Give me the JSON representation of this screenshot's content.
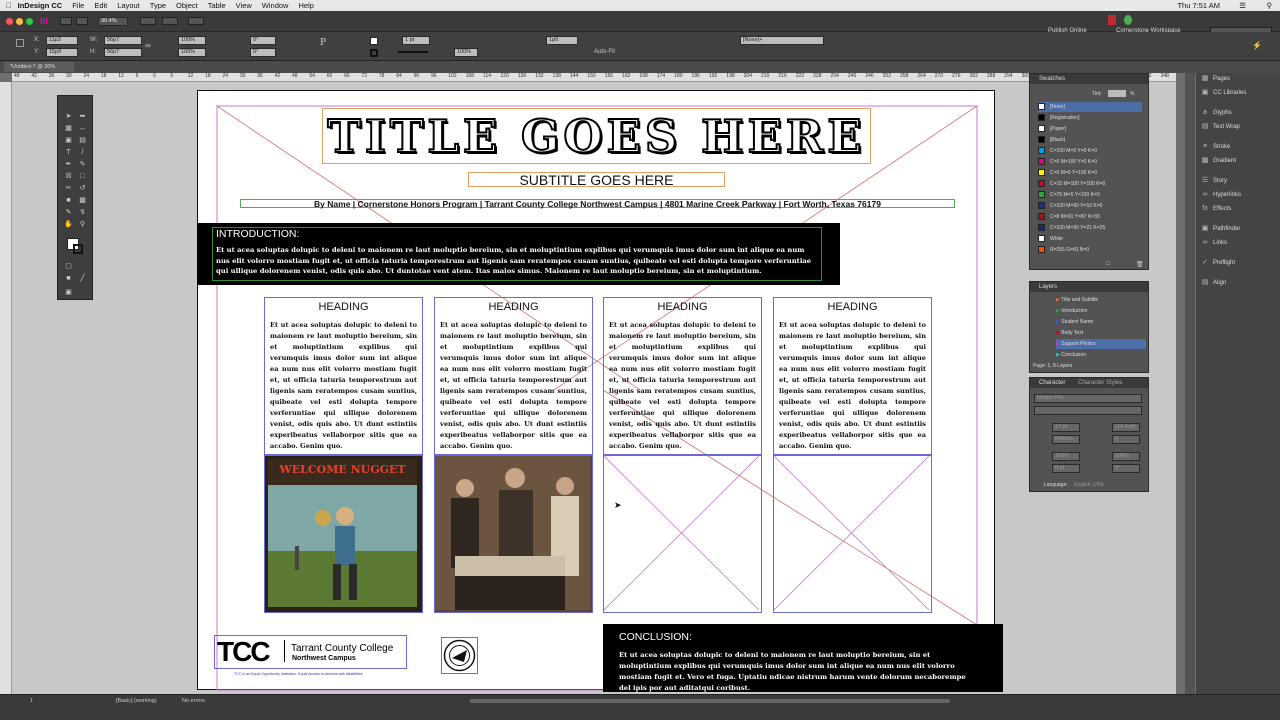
{
  "menubar": {
    "app_name": "InDesign CC",
    "items": [
      "File",
      "Edit",
      "Layout",
      "Type",
      "Object",
      "Table",
      "View",
      "Window",
      "Help"
    ],
    "clock": "Thu 7:51 AM"
  },
  "appbar": {
    "zoom": "30.4%",
    "publish": "Publish Online",
    "workspace": "Cornerstone Workspace"
  },
  "control": {
    "x": "11p3",
    "y": "15p9",
    "w": "56p7",
    "h": "56p7",
    "scale_x": "100%",
    "scale_y": "100%",
    "angle": "0°",
    "shear": "0°",
    "stroke": "1 pt",
    "style": "[None]+",
    "gap": "100%",
    "autofit": "Auto-Fit",
    "spacing": "1p0"
  },
  "doc_tab": "*Untitled-7 @ 30%",
  "ruler": [
    "48",
    "42",
    "36",
    "30",
    "24",
    "18",
    "12",
    "6",
    "0",
    "6",
    "12",
    "18",
    "24",
    "30",
    "36",
    "42",
    "48",
    "54",
    "60",
    "66",
    "72",
    "78",
    "84",
    "90",
    "96",
    "102",
    "108",
    "114",
    "120",
    "126",
    "132",
    "138",
    "144",
    "150",
    "156",
    "162",
    "168",
    "174",
    "180",
    "186",
    "192",
    "198",
    "204",
    "210",
    "216",
    "222",
    "228",
    "234",
    "240",
    "246",
    "252",
    "258",
    "264",
    "270",
    "276",
    "282",
    "288",
    "294",
    "300",
    "306",
    "312",
    "318",
    "324",
    "330",
    "336",
    "342",
    "348"
  ],
  "document": {
    "title": "TITLE GOES HERE",
    "subtitle": "SUBTITLE GOES HERE",
    "byline": "By Name |  Cornerstone Honors Program  |  Tarrant County College Northwest Campus  |  4801 Marine Creek Parkway  |  Fort Worth, Texas  76179",
    "intro_title": "INTRODUCTION:",
    "intro_body": "Et ut acea soluptas dolupic to deleni to maionem re laut moluptio bereium, sin et moluptintium explibus qui verumquis imus dolor sum int alique ea num nus elit volorro mostiam fugit et, ut officia taturia temporestrum aut ligenis sam reratempos cusam suntius, quibeate vel esti dolupta tempore verferuntiae qui ullique dolorenem venist, odis quis abo. Ut duntotae vent atem. Itas maios simus. Maionem re laut moluptio bereium, sin et moluptintium.",
    "columns": [
      {
        "heading": "HEADING",
        "body": "Et ut acea soluptas dolupic to deleni to maionem re laut moluptio bereium, sin et moluptintium explibus qui verumquis imus dolor sum int alique ea num nus elit volorro mostiam fugit et, ut officia taturia temporestrum aut ligenis sam reratempos cusam suntius, quibeate vel esti dolupta tempore verferuntiae qui ullique dolorenem venist, odis quis abo. Ut dunt estintiis experibeatus vellaborpor sitis que ea accabo. Genim quo."
      },
      {
        "heading": "HEADING",
        "body": "Et ut acea soluptas dolupic to deleni to maionem re laut moluptio bereium, sin et moluptintium explibus qui verumquis imus dolor sum int alique ea num nus elit volorro mostiam fugit et, ut officia taturia temporestrum aut ligenis sam reratempos cusam suntius, quibeate vel esti dolupta tempore verferuntiae qui ullique dolorenem venist, odis quis abo. Ut dunt estintiis experibeatus vellaborpor sitis que ea accabo. Genim quo."
      },
      {
        "heading": "HEADING",
        "body": "Et ut acea soluptas dolupic to deleni to maionem re laut moluptio bereium, sin et moluptintium explibus qui verumquis imus dolor sum int alique ea num nus elit volorro mostiam fugit et, ut officia taturia temporestrum aut ligenis sam reratempos cusam suntius, quibeate vel esti dolupta tempore verferuntiae qui ullique dolorenem venist, odis quis abo. Ut dunt estintiis experibeatus vellaborpor sitis que ea accabo. Genim quo."
      },
      {
        "heading": "HEADING",
        "body": "Et ut acea soluptas dolupic to deleni to maionem re laut moluptio bereium, sin et moluptintium explibus qui verumquis imus dolor sum int alique ea num nus elit volorro mostiam fugit et, ut officia taturia temporestrum aut ligenis sam reratempos cusam suntius, quibeate vel esti dolupta tempore verferuntiae qui ullique dolorenem venist, odis quis abo. Ut dunt estintiis experibeatus vellaborpor sitis que ea accabo. Genim quo."
      }
    ],
    "image1_caption": "WELCOME NUGGET",
    "conclusion_title": "CONCLUSION:",
    "conclusion_body": "Et ut acea soluptas dolupic to deleni to maionem re laut moluptio bereium, sin et moluptintium explibus qui verumquis imus dolor sum int alique ea num nus elit volorro mostiam fugit et. Vero et fuga. Uptatiu ndicae nistrum harum vente dolorum necaborempe del ipis por aut aditatqui coribust.",
    "logo_tcc": "TCC",
    "logo_college": "Tarrant County College",
    "logo_campus": "Northwest Campus",
    "logo_fine_print": "TCC is an Equal Opportunity Institution. Equal Access to persons with disabilities."
  },
  "swatches": {
    "title": "Swatches",
    "tint_label": "Tint:",
    "tint_value": "%",
    "items": [
      {
        "name": "[None]",
        "color": "#ffffff"
      },
      {
        "name": "[Registration]",
        "color": "#000000"
      },
      {
        "name": "[Paper]",
        "color": "#ffffff"
      },
      {
        "name": "[Black]",
        "color": "#000000"
      },
      {
        "name": "C=100 M=0 Y=0 K=0",
        "color": "#00a0e9"
      },
      {
        "name": "C=0 M=100 Y=0 K=0",
        "color": "#e4007f"
      },
      {
        "name": "C=0 M=0 Y=100 K=0",
        "color": "#fff100"
      },
      {
        "name": "C=15 M=100 Y=100 K=0",
        "color": "#d7001d"
      },
      {
        "name": "C=75 M=5 Y=100 K=0",
        "color": "#2ea836"
      },
      {
        "name": "C=100 M=90 Y=10 K=0",
        "color": "#1d2f8c"
      },
      {
        "name": "C=8 M=91 Y=87 K=33",
        "color": "#a5151c"
      },
      {
        "name": "C=100 M=90 Y=21 K=25",
        "color": "#1c2870"
      },
      {
        "name": "White",
        "color": "#ffffff"
      },
      {
        "name": "R=255 G=81 B=0",
        "color": "#ff5100"
      }
    ]
  },
  "layers": {
    "title": "Layers",
    "items": [
      {
        "name": "Title and Subtitle",
        "color": "#e07030"
      },
      {
        "name": "Introduction",
        "color": "#2ea836"
      },
      {
        "name": "Student Name",
        "color": "#3b5bdb"
      },
      {
        "name": "Body Text",
        "color": "#d7001d"
      },
      {
        "name": "Support Photos",
        "color": "#c040c0"
      },
      {
        "name": "Conclusion",
        "color": "#3bc0c0"
      }
    ],
    "footer": "Page: 1, 8 Layers"
  },
  "character": {
    "title": "Character",
    "tab2": "Character Styles",
    "font": "Minion Pro",
    "size": "12 pt",
    "leading": "(14.4 pt)",
    "kerning": "Metrics",
    "tracking": "0",
    "scale_v": "100%",
    "scale_h": "100%",
    "baseline": "0 pt",
    "skew": "0°",
    "language_label": "Language:",
    "language": "English: USA"
  },
  "right_bar": [
    "Pages",
    "CC Libraries",
    "Glyphs",
    "Text Wrap",
    "Stroke",
    "Gradient",
    "Story",
    "Hyperlinks",
    "Effects",
    "Pathfinder",
    "Links",
    "Preflight",
    "Align"
  ],
  "status": {
    "page": "1",
    "mode": "[Basic] (working)",
    "errors": "No errors"
  }
}
